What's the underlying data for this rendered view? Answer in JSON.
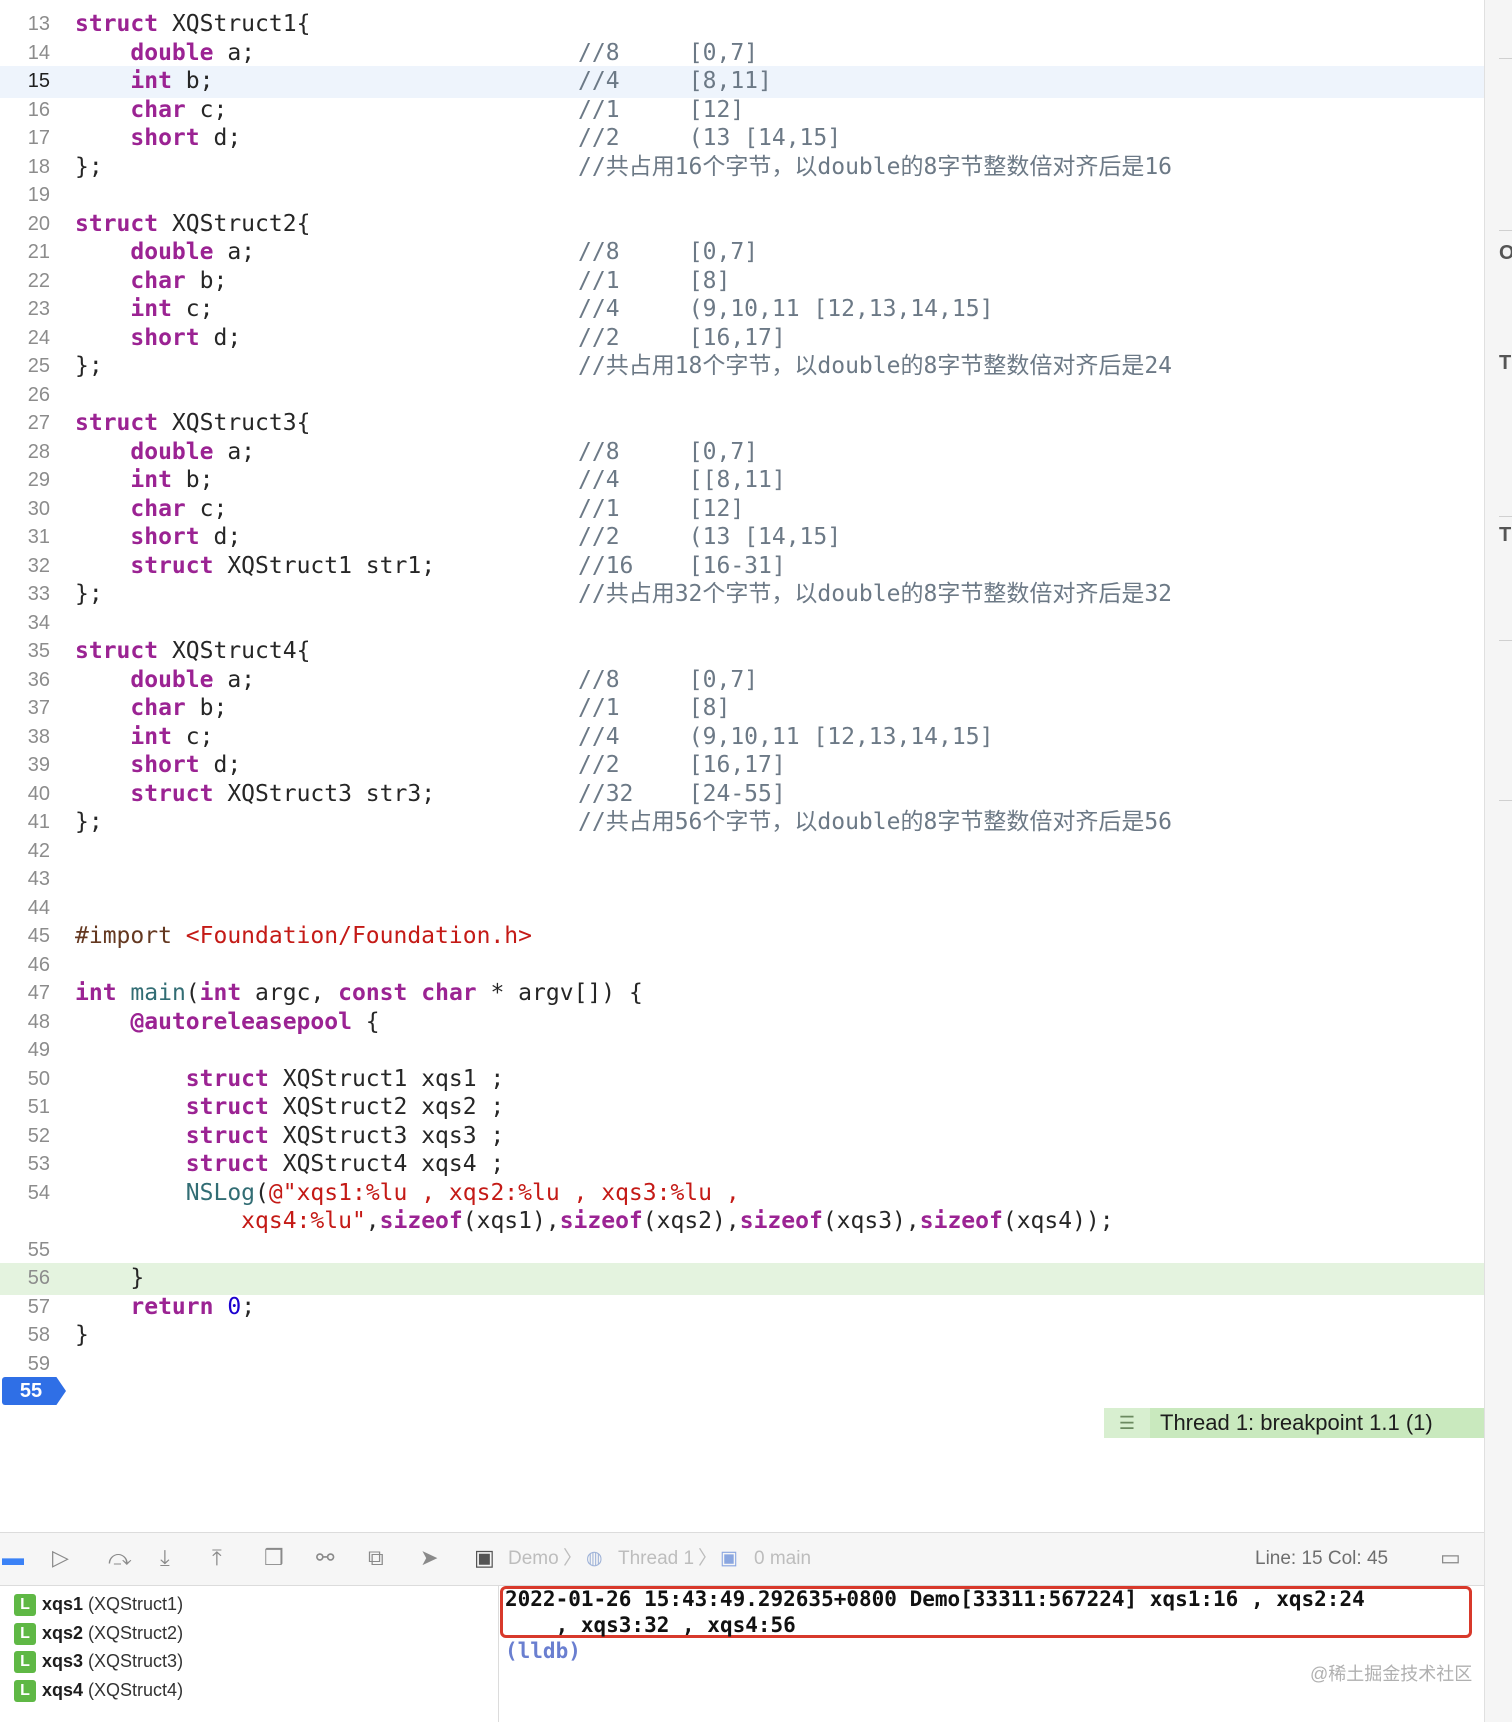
{
  "editor": {
    "lines": [
      {
        "n": "13",
        "code": [
          [
            "kw",
            "struct"
          ],
          [
            "p",
            " XQStruct1{"
          ]
        ],
        "comment": ""
      },
      {
        "n": "14",
        "code": [
          [
            "p",
            "    "
          ],
          [
            "kw",
            "double"
          ],
          [
            "p",
            " a;"
          ]
        ],
        "comment": "//8     [0,7]"
      },
      {
        "n": "15",
        "code": [
          [
            "p",
            "    "
          ],
          [
            "kw",
            "int"
          ],
          [
            "p",
            " b;"
          ]
        ],
        "comment": "//4     [8,11]",
        "hl": true
      },
      {
        "n": "16",
        "code": [
          [
            "p",
            "    "
          ],
          [
            "kw",
            "char"
          ],
          [
            "p",
            " c;"
          ]
        ],
        "comment": "//1     [12]"
      },
      {
        "n": "17",
        "code": [
          [
            "p",
            "    "
          ],
          [
            "kw",
            "short"
          ],
          [
            "p",
            " d;"
          ]
        ],
        "comment": "//2     (13 [14,15]"
      },
      {
        "n": "18",
        "code": [
          [
            "p",
            "};"
          ]
        ],
        "comment": "//共占用16个字节，以double的8字节整数倍对齐后是16"
      },
      {
        "n": "19",
        "code": [],
        "comment": ""
      },
      {
        "n": "20",
        "code": [
          [
            "kw",
            "struct"
          ],
          [
            "p",
            " XQStruct2{"
          ]
        ],
        "comment": ""
      },
      {
        "n": "21",
        "code": [
          [
            "p",
            "    "
          ],
          [
            "kw",
            "double"
          ],
          [
            "p",
            " a;"
          ]
        ],
        "comment": "//8     [0,7]"
      },
      {
        "n": "22",
        "code": [
          [
            "p",
            "    "
          ],
          [
            "kw",
            "char"
          ],
          [
            "p",
            " b;"
          ]
        ],
        "comment": "//1     [8]"
      },
      {
        "n": "23",
        "code": [
          [
            "p",
            "    "
          ],
          [
            "kw",
            "int"
          ],
          [
            "p",
            " c;"
          ]
        ],
        "comment": "//4     (9,10,11 [12,13,14,15]"
      },
      {
        "n": "24",
        "code": [
          [
            "p",
            "    "
          ],
          [
            "kw",
            "short"
          ],
          [
            "p",
            " d;"
          ]
        ],
        "comment": "//2     [16,17]"
      },
      {
        "n": "25",
        "code": [
          [
            "p",
            "};"
          ]
        ],
        "comment": "//共占用18个字节，以double的8字节整数倍对齐后是24"
      },
      {
        "n": "26",
        "code": [],
        "comment": ""
      },
      {
        "n": "27",
        "code": [
          [
            "kw",
            "struct"
          ],
          [
            "p",
            " XQStruct3{"
          ]
        ],
        "comment": ""
      },
      {
        "n": "28",
        "code": [
          [
            "p",
            "    "
          ],
          [
            "kw",
            "double"
          ],
          [
            "p",
            " a;"
          ]
        ],
        "comment": "//8     [0,7]"
      },
      {
        "n": "29",
        "code": [
          [
            "p",
            "    "
          ],
          [
            "kw",
            "int"
          ],
          [
            "p",
            " b;"
          ]
        ],
        "comment": "//4     [[8,11]"
      },
      {
        "n": "30",
        "code": [
          [
            "p",
            "    "
          ],
          [
            "kw",
            "char"
          ],
          [
            "p",
            " c;"
          ]
        ],
        "comment": "//1     [12]"
      },
      {
        "n": "31",
        "code": [
          [
            "p",
            "    "
          ],
          [
            "kw",
            "short"
          ],
          [
            "p",
            " d;"
          ]
        ],
        "comment": "//2     (13 [14,15]"
      },
      {
        "n": "32",
        "code": [
          [
            "p",
            "    "
          ],
          [
            "kw",
            "struct"
          ],
          [
            "p",
            " XQStruct1 str1;"
          ]
        ],
        "comment": "//16    [16-31]"
      },
      {
        "n": "33",
        "code": [
          [
            "p",
            "};"
          ]
        ],
        "comment": "//共占用32个字节，以double的8字节整数倍对齐后是32"
      },
      {
        "n": "34",
        "code": [],
        "comment": ""
      },
      {
        "n": "35",
        "code": [
          [
            "kw",
            "struct"
          ],
          [
            "p",
            " XQStruct4{"
          ]
        ],
        "comment": ""
      },
      {
        "n": "36",
        "code": [
          [
            "p",
            "    "
          ],
          [
            "kw",
            "double"
          ],
          [
            "p",
            " a;"
          ]
        ],
        "comment": "//8     [0,7]"
      },
      {
        "n": "37",
        "code": [
          [
            "p",
            "    "
          ],
          [
            "kw",
            "char"
          ],
          [
            "p",
            " b;"
          ]
        ],
        "comment": "//1     [8]"
      },
      {
        "n": "38",
        "code": [
          [
            "p",
            "    "
          ],
          [
            "kw",
            "int"
          ],
          [
            "p",
            " c;"
          ]
        ],
        "comment": "//4     (9,10,11 [12,13,14,15]"
      },
      {
        "n": "39",
        "code": [
          [
            "p",
            "    "
          ],
          [
            "kw",
            "short"
          ],
          [
            "p",
            " d;"
          ]
        ],
        "comment": "//2     [16,17]"
      },
      {
        "n": "40",
        "code": [
          [
            "p",
            "    "
          ],
          [
            "kw",
            "struct"
          ],
          [
            "p",
            " XQStruct3 str3;"
          ]
        ],
        "comment": "//32    [24-55]"
      },
      {
        "n": "41",
        "code": [
          [
            "p",
            "};"
          ]
        ],
        "comment": "//共占用56个字节，以double的8字节整数倍对齐后是56"
      },
      {
        "n": "42",
        "code": [],
        "comment": ""
      },
      {
        "n": "43",
        "code": [],
        "comment": ""
      },
      {
        "n": "44",
        "code": [],
        "comment": ""
      },
      {
        "n": "45",
        "code": [
          [
            "dir",
            "#import "
          ],
          [
            "inc",
            "<Foundation/Foundation.h>"
          ]
        ],
        "comment": ""
      },
      {
        "n": "46",
        "code": [],
        "comment": ""
      },
      {
        "n": "47",
        "code": [
          [
            "kw",
            "int"
          ],
          [
            "p",
            " "
          ],
          [
            "fn",
            "main"
          ],
          [
            "p",
            "("
          ],
          [
            "kw",
            "int"
          ],
          [
            "p",
            " argc, "
          ],
          [
            "kw",
            "const"
          ],
          [
            "p",
            " "
          ],
          [
            "kw",
            "char"
          ],
          [
            "p",
            " * argv[]) {"
          ]
        ],
        "comment": ""
      },
      {
        "n": "48",
        "code": [
          [
            "p",
            "    "
          ],
          [
            "kw",
            "@autoreleasepool"
          ],
          [
            "p",
            " {"
          ]
        ],
        "comment": ""
      },
      {
        "n": "49",
        "code": [],
        "comment": ""
      },
      {
        "n": "50",
        "code": [
          [
            "p",
            "        "
          ],
          [
            "kw",
            "struct"
          ],
          [
            "p",
            " XQStruct1 xqs1 ;"
          ]
        ],
        "comment": ""
      },
      {
        "n": "51",
        "code": [
          [
            "p",
            "        "
          ],
          [
            "kw",
            "struct"
          ],
          [
            "p",
            " XQStruct2 xqs2 ;"
          ]
        ],
        "comment": ""
      },
      {
        "n": "52",
        "code": [
          [
            "p",
            "        "
          ],
          [
            "kw",
            "struct"
          ],
          [
            "p",
            " XQStruct3 xqs3 ;"
          ]
        ],
        "comment": ""
      },
      {
        "n": "53",
        "code": [
          [
            "p",
            "        "
          ],
          [
            "kw",
            "struct"
          ],
          [
            "p",
            " XQStruct4 xqs4 ;"
          ]
        ],
        "comment": ""
      },
      {
        "n": "54",
        "code": [
          [
            "p",
            "        "
          ],
          [
            "fn",
            "NSLog"
          ],
          [
            "p",
            "("
          ],
          [
            "str",
            "@\"xqs1:%lu , xqs2:%lu , xqs3:%lu ,"
          ]
        ],
        "comment": ""
      },
      {
        "n": "",
        "code": [
          [
            "p",
            "            "
          ],
          [
            "str",
            "xqs4:%lu\""
          ],
          [
            "p",
            ","
          ],
          [
            "kw",
            "sizeof"
          ],
          [
            "p",
            "(xqs1),"
          ],
          [
            "kw",
            "sizeof"
          ],
          [
            "p",
            "(xqs2),"
          ],
          [
            "kw",
            "sizeof"
          ],
          [
            "p",
            "(xqs3),"
          ],
          [
            "kw",
            "sizeof"
          ],
          [
            "p",
            "(xqs4));"
          ]
        ],
        "comment": ""
      },
      {
        "n": "55",
        "code": [],
        "comment": "",
        "bp": true
      },
      {
        "n": "56",
        "code": [
          [
            "p",
            "    }"
          ]
        ],
        "comment": "",
        "bpline": true
      },
      {
        "n": "57",
        "code": [
          [
            "p",
            "    "
          ],
          [
            "kw",
            "return"
          ],
          [
            "p",
            " "
          ],
          [
            "num",
            "0"
          ],
          [
            "p",
            ";"
          ]
        ],
        "comment": ""
      },
      {
        "n": "58",
        "code": [
          [
            "p",
            "}"
          ]
        ],
        "comment": ""
      },
      {
        "n": "59",
        "code": [],
        "comment": ""
      }
    ],
    "breakpoint_label": "Thread 1: breakpoint 1.1 (1)"
  },
  "debug_bar": {
    "crumbs": [
      "Demo",
      "Thread 1",
      "0 main"
    ],
    "line_col": "Line: 15  Col: 45"
  },
  "variables": [
    {
      "name": "xqs1",
      "type": "(XQStruct1)"
    },
    {
      "name": "xqs2",
      "type": "(XQStruct2)"
    },
    {
      "name": "xqs3",
      "type": "(XQStruct3)"
    },
    {
      "name": "xqs4",
      "type": "(XQStruct4)"
    }
  ],
  "console": {
    "log": "2022-01-26 15:43:49.292635+0800 Demo[33311:567224] xqs1:16 , xqs2:24\n    , xqs3:32 , xqs4:56",
    "prompt": "(lldb)"
  },
  "watermark": "@稀土掘金技术社区",
  "right_panel_letters": [
    "O",
    "T",
    "T"
  ],
  "colors": {
    "keyword": "#9b2393",
    "string": "#c41a16",
    "breakpoint": "#2f6fe6",
    "highlight": "#eef4fc",
    "log_border": "#d8392b"
  }
}
